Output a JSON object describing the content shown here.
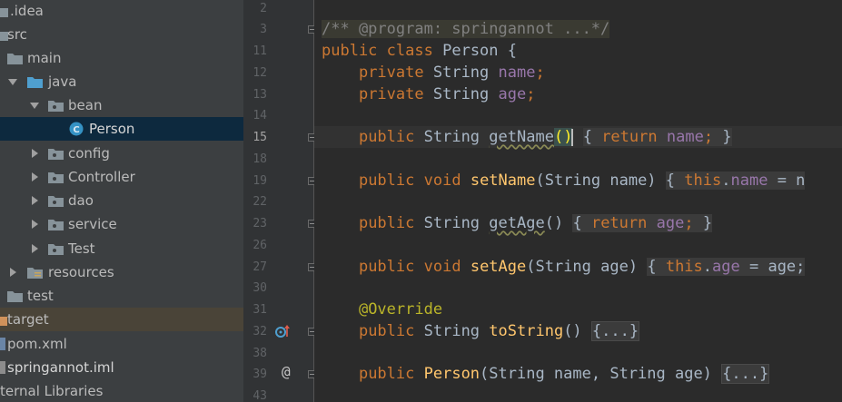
{
  "tree": {
    "items": [
      {
        "label": ".idea",
        "kind": "folder",
        "indent": 0
      },
      {
        "label": "src",
        "kind": "folder",
        "indent": 0
      },
      {
        "label": "main",
        "kind": "folder",
        "indent": 1
      },
      {
        "label": "java",
        "kind": "source-folder",
        "indent": 2
      },
      {
        "label": "bean",
        "kind": "package",
        "indent": 3
      },
      {
        "label": "Person",
        "kind": "class",
        "indent": 4
      },
      {
        "label": "config",
        "kind": "package",
        "indent": 3
      },
      {
        "label": "Controller",
        "kind": "package",
        "indent": 3
      },
      {
        "label": "dao",
        "kind": "package",
        "indent": 3
      },
      {
        "label": "service",
        "kind": "package",
        "indent": 3
      },
      {
        "label": "Test",
        "kind": "package",
        "indent": 3
      },
      {
        "label": "resources",
        "kind": "resources-folder",
        "indent": 2
      },
      {
        "label": "test",
        "kind": "folder",
        "indent": 1
      },
      {
        "label": "target",
        "kind": "excluded-folder",
        "indent": 0
      },
      {
        "label": "pom.xml",
        "kind": "maven-file",
        "indent": 0
      },
      {
        "label": "springannot.iml",
        "kind": "module-file",
        "indent": 0
      },
      {
        "label": "ternal Libraries",
        "kind": "libraries",
        "indent": 0
      }
    ],
    "selected": "Person",
    "colors": {
      "background": "#3c3f41",
      "selected": "#0d293e",
      "excluded": "#4a4438",
      "folder": "#87939a",
      "source_folder": "#4f9fcf",
      "class_icon": "#3592c4"
    }
  },
  "editor": {
    "line_numbers": [
      "2",
      "3",
      "11",
      "12",
      "13",
      "14",
      "15",
      "18",
      "19",
      "22",
      "23",
      "26",
      "27",
      "30",
      "31",
      "32",
      "38",
      "39",
      "43"
    ],
    "current_line": "15",
    "lines": {
      "l3": {
        "comment": "/** @program: springannot ...*/"
      },
      "l11": {
        "kw1": "public",
        "kw2": "class",
        "name": "Person",
        "brace": "{"
      },
      "l12": {
        "kw": "private",
        "type": "String",
        "field": "name",
        "semi": ";"
      },
      "l13": {
        "kw": "private",
        "type": "String",
        "field": "age",
        "semi": ";"
      },
      "l15": {
        "kw": "public",
        "type": "String",
        "method": "getName",
        "parens": "()",
        "fold_open": "{",
        "ret": "return",
        "field": "name",
        "semi": ";",
        "fold_close": "}"
      },
      "l19": {
        "kw1": "public",
        "kw2": "void",
        "method": "setName",
        "params": "(String name)",
        "fold_open": "{",
        "this": "this",
        "dot": ".",
        "field": "name",
        "rest": " = n"
      },
      "l23": {
        "kw": "public",
        "type": "String",
        "method": "getAge",
        "parens": "()",
        "fold_open": "{",
        "ret": "return",
        "field": "age",
        "semi": ";",
        "fold_close": "}"
      },
      "l27": {
        "kw1": "public",
        "kw2": "void",
        "method": "setAge",
        "params": "(String age)",
        "fold_open": "{",
        "this": "this",
        "dot": ".",
        "field": "age",
        "rest": " = age;"
      },
      "l31": {
        "annotation": "@Override"
      },
      "l32": {
        "kw": "public",
        "type": "String",
        "method": "toString",
        "parens": "()",
        "folded": "{...}"
      },
      "l39": {
        "kw": "public",
        "method": "Person",
        "params": "(String name, String age)",
        "folded": "{...}"
      }
    },
    "gutter_marks": {
      "line32": "override-icon",
      "line39": "@"
    }
  }
}
